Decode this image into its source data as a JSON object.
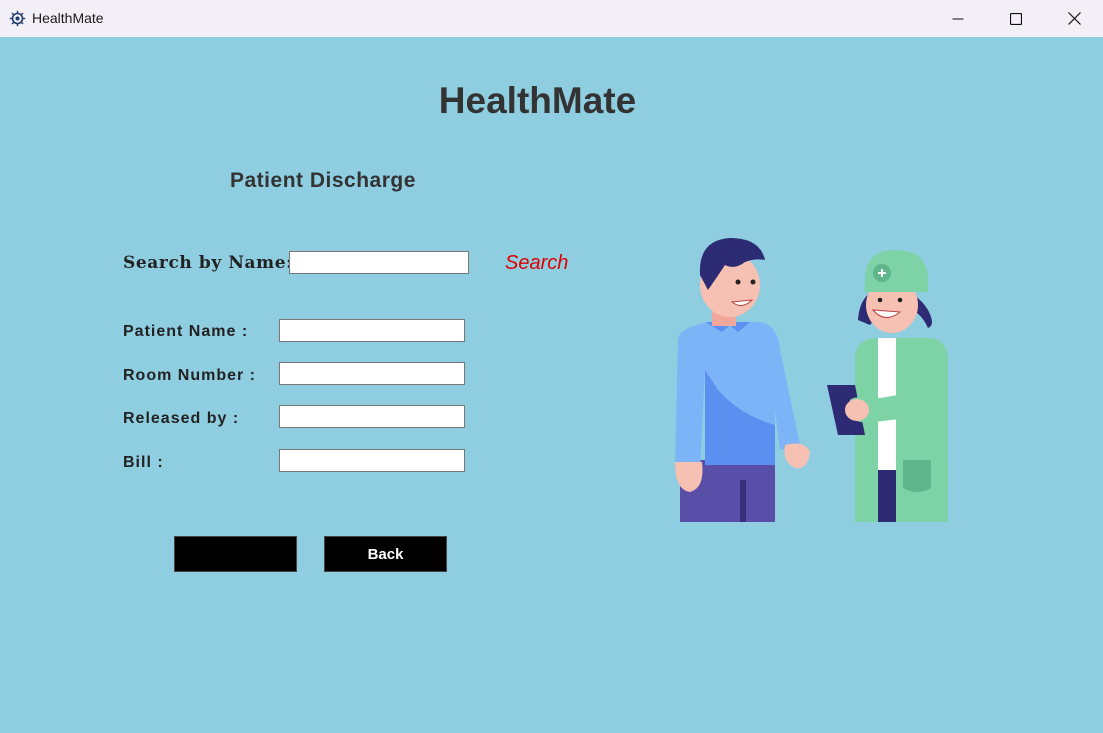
{
  "window": {
    "title": "HealthMate",
    "controls": [
      "minimize-icon",
      "maximize-icon",
      "close-icon"
    ]
  },
  "page": {
    "heading": "HealthMate",
    "section_title": "Patient Discharge"
  },
  "search": {
    "label": "Search by Name:",
    "value": "",
    "button_label": "Search",
    "button_color": "#e00000"
  },
  "form": {
    "fields": [
      {
        "label": "Patient Name :",
        "value": ""
      },
      {
        "label": "Room Number :",
        "value": ""
      },
      {
        "label": "Released by :",
        "value": ""
      },
      {
        "label": "Bill :",
        "value": ""
      }
    ]
  },
  "buttons": {
    "discharge_label": "",
    "back_label": "Back"
  },
  "colors": {
    "background": "#8fcde0",
    "button_bg": "#000000"
  },
  "illustration": {
    "icon": "patient-and-nurse-illustration"
  }
}
